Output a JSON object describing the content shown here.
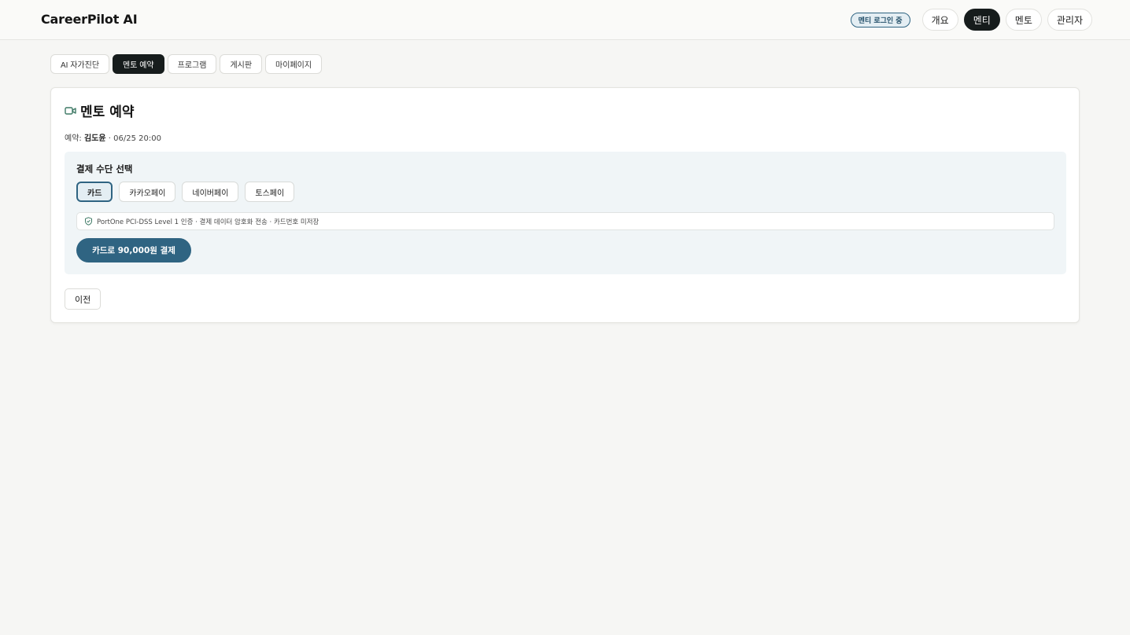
{
  "header": {
    "brand": "CareerPilot AI",
    "status_badge": "멘티 로그인 중",
    "nav": [
      {
        "label": "개요",
        "active": false
      },
      {
        "label": "멘티",
        "active": true
      },
      {
        "label": "멘토",
        "active": false
      },
      {
        "label": "관리자",
        "active": false
      }
    ]
  },
  "tabs": [
    {
      "label": "AI 자가진단",
      "active": false
    },
    {
      "label": "멘토 예약",
      "active": true
    },
    {
      "label": "프로그램",
      "active": false
    },
    {
      "label": "게시판",
      "active": false
    },
    {
      "label": "마이페이지",
      "active": false
    }
  ],
  "card": {
    "icon": "video-camera-icon",
    "title": "멘토 예약",
    "booking_prefix": "예약:",
    "mentor_name": "김도윤",
    "booking_time": "· 06/25 20:00"
  },
  "payment": {
    "heading": "결제 수단 선택",
    "methods": [
      {
        "label": "카드",
        "selected": true
      },
      {
        "label": "카카오페이",
        "selected": false
      },
      {
        "label": "네이버페이",
        "selected": false
      },
      {
        "label": "토스페이",
        "selected": false
      }
    ],
    "security_icon": "shield-check-icon",
    "security_note": "PortOne PCI-DSS Level 1 인증 · 결제 데이터 암호화 전송 · 카드번호 미저장",
    "pay_button": "카드로 90,000원 결제"
  },
  "prev_button": "이전",
  "colors": {
    "accent": "#2f6482",
    "accent_light": "#e4eef3",
    "dark": "#161c1c",
    "icon_green": "#3f7a66"
  }
}
